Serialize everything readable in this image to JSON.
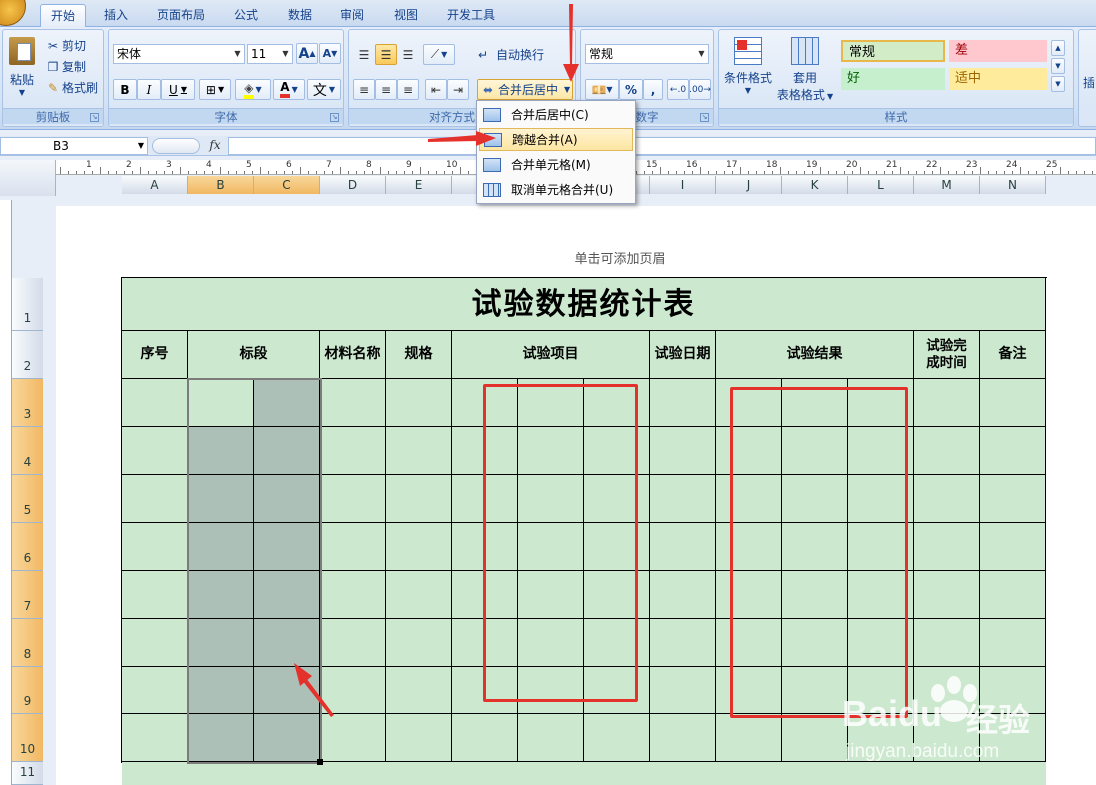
{
  "tabs": [
    "开始",
    "插入",
    "页面布局",
    "公式",
    "数据",
    "审阅",
    "视图",
    "开发工具"
  ],
  "clipboard": {
    "paste": "粘贴",
    "cut": "剪切",
    "copy": "复制",
    "format_painter": "格式刷",
    "label": "剪贴板"
  },
  "font": {
    "name": "宋体",
    "size": "11",
    "grow": "A",
    "shrink": "A",
    "bold": "B",
    "italic": "I",
    "underline": "U",
    "font_color": "A",
    "phonetic": "文",
    "label": "字体"
  },
  "alignment": {
    "wrap": "自动换行",
    "merge_center": "合并后居中",
    "label": "对齐方式"
  },
  "number": {
    "format": "常规",
    "percent": "%",
    "comma": ",",
    "label": "数字"
  },
  "styles": {
    "conditional": "条件格式",
    "table_line1": "套用",
    "table_line2": "表格格式",
    "normal": "常规",
    "bad": "差",
    "good": "好",
    "neutral": "适中",
    "label": "样式"
  },
  "right_edge_label": "插",
  "merge_menu": [
    "合并后居中(C)",
    "跨越合并(A)",
    "合并单元格(M)",
    "取消单元格合并(U)"
  ],
  "name_box": "B3",
  "fx": "fx",
  "columns": [
    "A",
    "B",
    "C",
    "D",
    "E",
    "F",
    "G",
    "H",
    "I",
    "J",
    "K",
    "L",
    "M",
    "N"
  ],
  "rows": [
    "1",
    "2",
    "3",
    "4",
    "5",
    "6",
    "7",
    "8",
    "9",
    "10",
    "11"
  ],
  "ruler_numbers": [
    "1",
    "2",
    "3",
    "4",
    "5",
    "6",
    "7",
    "8",
    "9",
    "10",
    "11",
    "12",
    "13",
    "14",
    "15",
    "16",
    "17",
    "18",
    "19",
    "20",
    "21",
    "22",
    "23",
    "24",
    "25"
  ],
  "header_hint": "单击可添加页眉",
  "sheet": {
    "title": "试验数据统计表",
    "headers": {
      "seq": "序号",
      "section": "标段",
      "material": "材料名称",
      "spec": "规格",
      "test_item": "试验项目",
      "test_date": "试验日期",
      "test_result": "试验结果",
      "completion": "试验完成时间",
      "note": "备注"
    }
  },
  "watermark": {
    "brand": "Baidu",
    "product": "经验",
    "url": "jingyan.baidu.com"
  },
  "colors": {
    "cell_fill": "#cce8cf",
    "selection": "#adc0b8",
    "annotation": "#e5312b"
  }
}
